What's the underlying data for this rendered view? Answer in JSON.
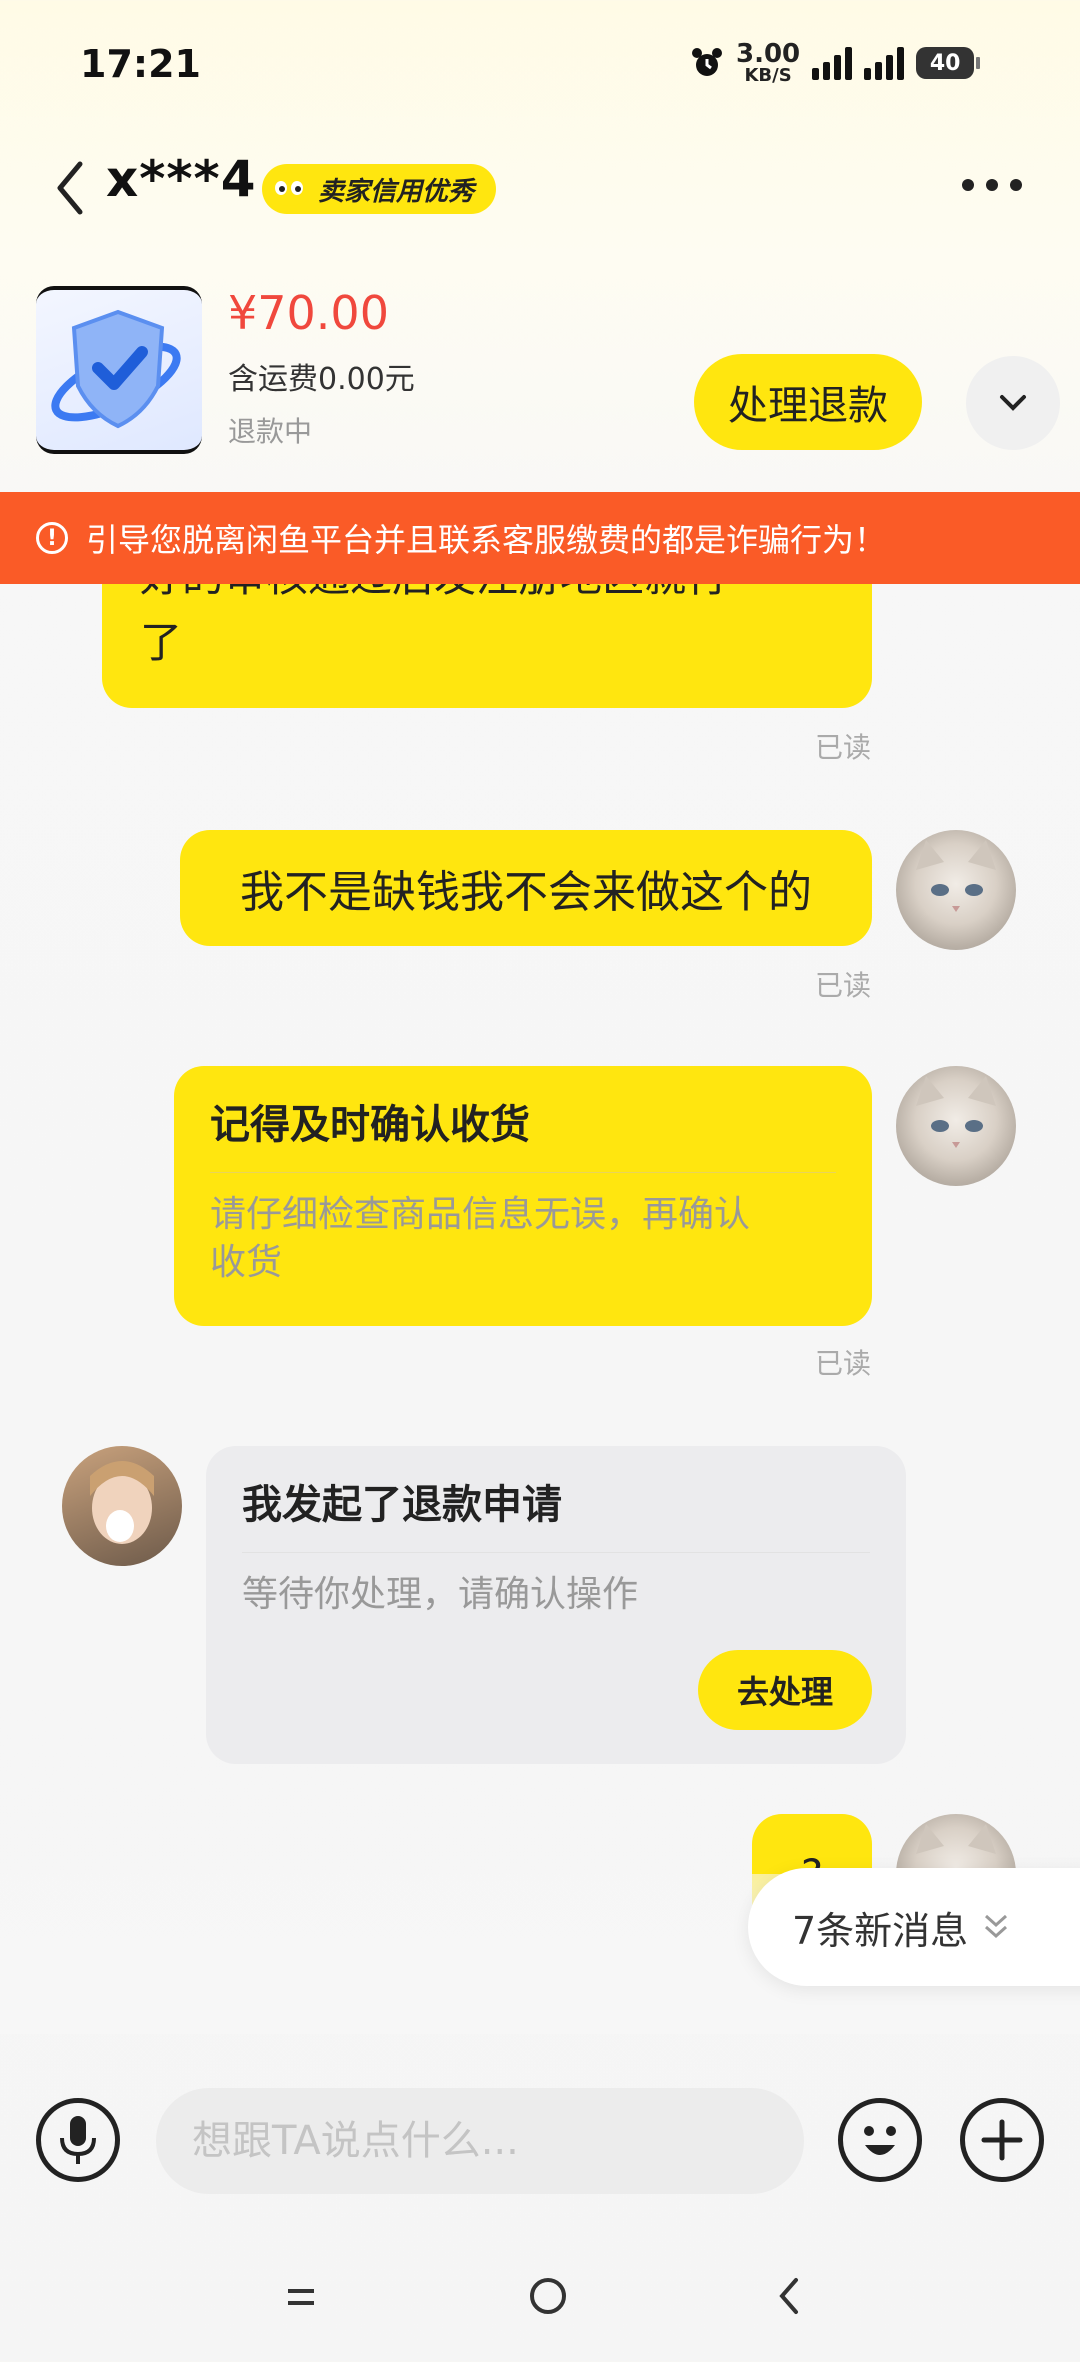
{
  "status_bar": {
    "time": "17:21",
    "speed_value": "3.00",
    "speed_unit": "KB/S",
    "battery": "40"
  },
  "header": {
    "title": "x***4",
    "badge": "卖家信用优秀"
  },
  "product": {
    "price": "¥70.00",
    "shipping": "含运费0.00元",
    "status": "退款中",
    "action": "处理退款"
  },
  "warning": "引导您脱离闲鱼平台并且联系客服缴费的都是诈骗行为！",
  "messages": {
    "m1_text_line1": "好的审核通过后发注册地区就行",
    "m1_text_line2": "了",
    "m1_read": "已读",
    "m2_text": "我不是缺钱我不会来做这个的",
    "m2_read": "已读",
    "m3_title": "记得及时确认收货",
    "m3_desc_line1": "请仔细检查商品信息无误，再确认",
    "m3_desc_line2": "收货",
    "m3_read": "已读",
    "m4_title": "我发起了退款申请",
    "m4_desc": "等待你处理，请确认操作",
    "m4_button": "去处理",
    "m5_text": "?"
  },
  "new_messages": "7条新消息",
  "input": {
    "placeholder": "想跟TA说点什么..."
  },
  "colors": {
    "accent": "#ffe60f",
    "warning": "#fa5b27",
    "price": "#f0483d"
  }
}
